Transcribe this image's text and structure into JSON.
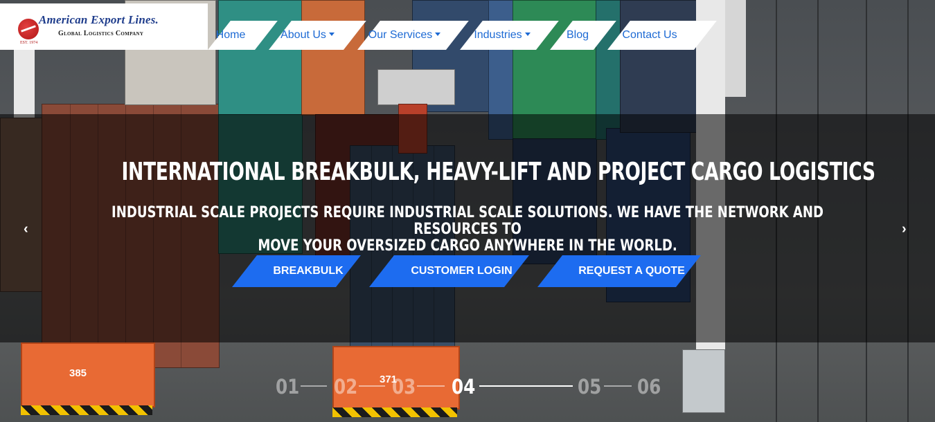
{
  "brand": {
    "name": "American Export Lines.",
    "tagline": "Global Logistics Company",
    "est": "EST. 1974"
  },
  "nav": {
    "items": [
      {
        "label": "Home",
        "dropdown": false
      },
      {
        "label": "About Us",
        "dropdown": true
      },
      {
        "label": "Our Services",
        "dropdown": true
      },
      {
        "label": "Industries",
        "dropdown": true
      },
      {
        "label": "Blog",
        "dropdown": false
      },
      {
        "label": "Contact Us",
        "dropdown": false
      }
    ]
  },
  "hero": {
    "title": "INTERNATIONAL BREAKBULK, HEAVY-LIFT AND PROJECT CARGO LOGISTICS",
    "subtitle_line1": "INDUSTRIAL SCALE PROJECTS REQUIRE INDUSTRIAL SCALE SOLUTIONS. WE HAVE THE NETWORK AND RESOURCES TO",
    "subtitle_line2": "MOVE YOUR OVERSIZED CARGO ANYWHERE IN THE WORLD.",
    "buttons": [
      "BREAKBULK",
      "CUSTOMER LOGIN",
      "REQUEST A QUOTE"
    ],
    "prev_arrow": "‹",
    "next_arrow": "›"
  },
  "pager": {
    "slides": [
      "01",
      "02",
      "03",
      "04",
      "05",
      "06"
    ],
    "active_index": 3
  },
  "background_labels": {
    "agv_left": "385",
    "agv_center": "371"
  },
  "colors": {
    "accent_blue": "#1d6cf0",
    "nav_text": "#1d6ad4",
    "brand_red": "#b01515",
    "brand_navy": "#1f3d8c"
  }
}
